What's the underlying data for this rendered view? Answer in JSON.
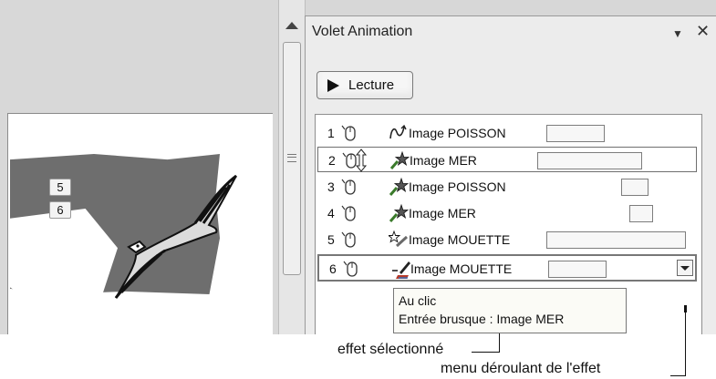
{
  "slide": {
    "tags": [
      "5",
      "6"
    ]
  },
  "pane": {
    "title": "Volet Animation",
    "play_label": "Lecture",
    "rows": [
      {
        "num": "1",
        "name": "Image POISSON"
      },
      {
        "num": "2",
        "name": "Image MER"
      },
      {
        "num": "3",
        "name": "Image POISSON"
      },
      {
        "num": "4",
        "name": "Image MER"
      },
      {
        "num": "5",
        "name": "Image MOUETTE"
      },
      {
        "num": "6",
        "name": "Image MOUETTE"
      }
    ]
  },
  "tooltip": {
    "line1": "Au clic",
    "line2": "Entrée brusque : Image MER"
  },
  "callouts": {
    "selected_effect": "effet sélectionné",
    "effect_menu": "menu déroulant de l'effet"
  },
  "icons": {
    "mouse": "mouse-icon",
    "motion_path": "motion-path-icon",
    "entrance": "entrance-star-icon",
    "emphasis": "emphasis-star-icon",
    "exit": "exit-brush-icon",
    "dropdown": "chevron-down-icon",
    "close": "close-icon"
  },
  "colors": {
    "pane_bg": "#ececec",
    "list_bg": "#ffffff",
    "sea": "#6e6e6e"
  }
}
